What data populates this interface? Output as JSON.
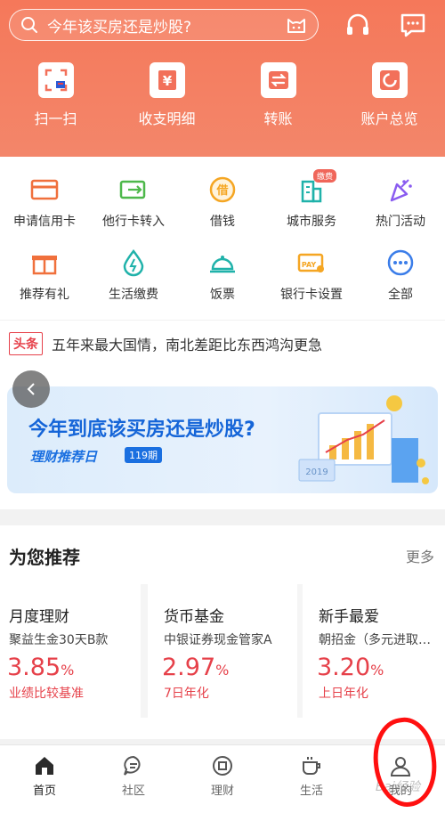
{
  "search": {
    "placeholder_text": "今年该买房还是炒股?"
  },
  "quick_actions": [
    {
      "label": "扫一扫",
      "icon": "scan-icon"
    },
    {
      "label": "收支明细",
      "icon": "yen-receipt-icon"
    },
    {
      "label": "转账",
      "icon": "transfer-icon"
    },
    {
      "label": "账户总览",
      "icon": "account-overview-icon"
    }
  ],
  "services_row1": [
    {
      "label": "申请信用卡",
      "icon": "credit-card-icon"
    },
    {
      "label": "他行卡转入",
      "icon": "card-transfer-in-icon"
    },
    {
      "label": "借钱",
      "icon": "borrow-icon"
    },
    {
      "label": "城市服务",
      "icon": "city-service-icon",
      "badge": "缴费"
    },
    {
      "label": "热门活动",
      "icon": "party-popper-icon"
    }
  ],
  "services_row2": [
    {
      "label": "推荐有礼",
      "icon": "gift-icon"
    },
    {
      "label": "生活缴费",
      "icon": "water-drop-icon"
    },
    {
      "label": "饭票",
      "icon": "food-bell-icon"
    },
    {
      "label": "银行卡设置",
      "icon": "pay-card-icon"
    },
    {
      "label": "全部",
      "icon": "more-dots-icon"
    }
  ],
  "news": {
    "tag": "头条",
    "text": "五年来最大国情，南北差距比东西鸿沟更急"
  },
  "banner": {
    "title": "今年到底该买房还是炒股?",
    "subtitle": "理财推荐日",
    "issue": "119期",
    "year_label": "2019"
  },
  "recommend": {
    "title": "为您推荐",
    "more": "更多"
  },
  "cards": [
    {
      "title": "月度理财",
      "name": "聚益生金30天B款",
      "rate": "3.85",
      "unit": "%",
      "desc": "业绩比较基准"
    },
    {
      "title": "货币基金",
      "name": "中银证券现金管家A",
      "rate": "2.97",
      "unit": "%",
      "desc": "7日年化"
    },
    {
      "title": "新手最爱",
      "name": "朝招金（多元进取…",
      "rate": "3.20",
      "unit": "%",
      "desc": "上日年化"
    }
  ],
  "tabs": [
    {
      "label": "首页",
      "icon": "home-icon"
    },
    {
      "label": "社区",
      "icon": "community-chat-icon"
    },
    {
      "label": "理财",
      "icon": "wealth-icon"
    },
    {
      "label": "生活",
      "icon": "coffee-cup-icon"
    },
    {
      "label": "我的",
      "icon": "person-icon"
    }
  ],
  "watermark": "Bai经验",
  "colors": {
    "header": "#f5785a",
    "accent_red": "#e6414a",
    "banner_blue": "#1565d8"
  }
}
